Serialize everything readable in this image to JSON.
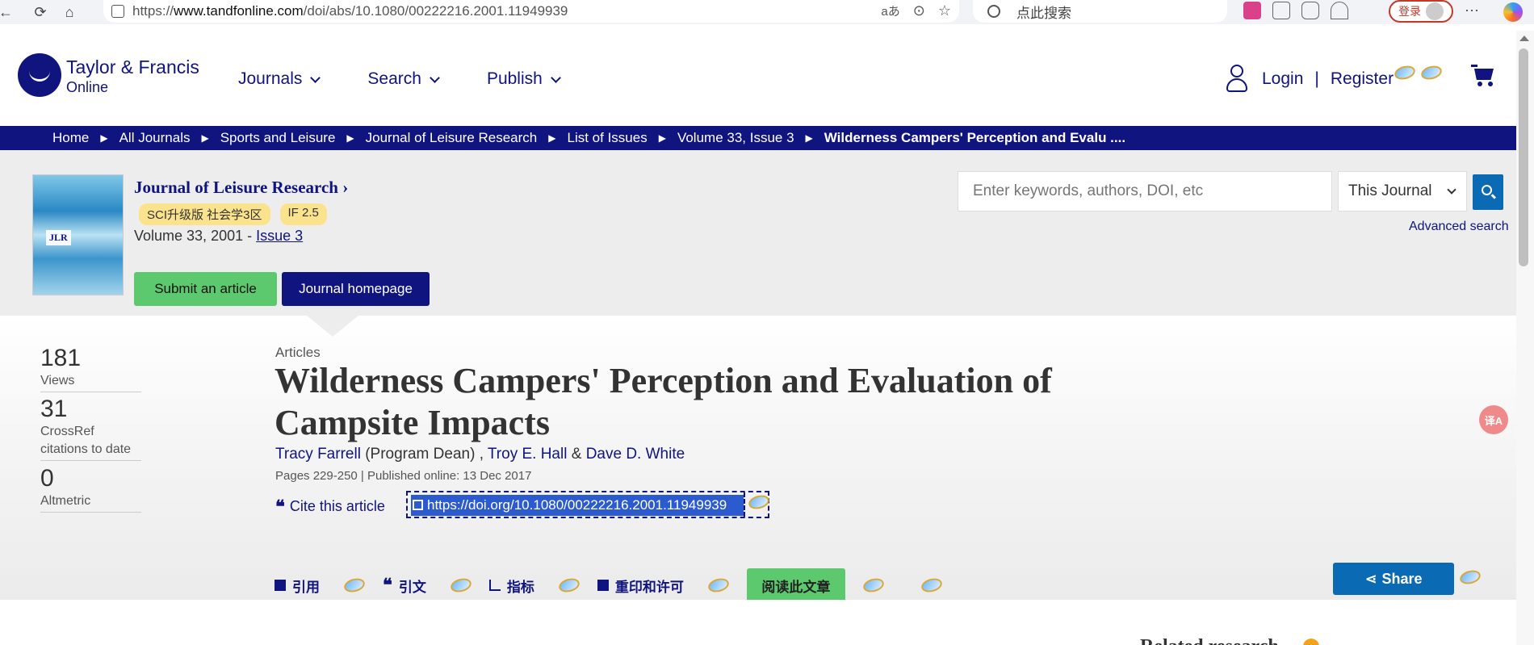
{
  "browser": {
    "url_prefix": "https://",
    "url_host": "www.tandfonline.com",
    "url_path": "/doi/abs/10.1080/00222216.2001.11949939",
    "search_placeholder": "点此搜索",
    "login_label": "登录",
    "reader_mode_label": "aあ"
  },
  "header": {
    "logo_line1": "Taylor & Francis",
    "logo_line2": "Online",
    "nav": [
      "Journals",
      "Search",
      "Publish"
    ],
    "login": "Login",
    "divider": "|",
    "register": "Register"
  },
  "breadcrumb": [
    "Home",
    "All Journals",
    "Sports and Leisure",
    "Journal of Leisure Research",
    "List of Issues",
    "Volume 33, Issue 3",
    "Wilderness Campers' Perception and Evalu ...."
  ],
  "journal": {
    "cover_text": "JLR",
    "title": "Journal of Leisure Research ›",
    "badges": [
      "SCI升级版 社会学3区",
      "IF 2.5"
    ],
    "volume_text": "Volume 33, 2001 - ",
    "issue_link": "Issue 3",
    "submit_label": "Submit an article",
    "homepage_label": "Journal homepage",
    "search_placeholder": "Enter keywords, authors, DOI, etc",
    "scope_select": "This Journal",
    "advanced_search": "Advanced search"
  },
  "metrics": [
    {
      "value": "181",
      "label": "Views"
    },
    {
      "value": "31",
      "label": "CrossRef citations to date"
    },
    {
      "value": "0",
      "label": "Altmetric"
    }
  ],
  "article": {
    "type": "Articles",
    "title": "Wilderness Campers' Perception and Evaluation of Campsite Impacts",
    "author1": "Tracy Farrell",
    "author1_role": " (Program Dean) , ",
    "author2": "Troy E. Hall",
    "amp": " & ",
    "author3": "Dave D. White",
    "pub_info": "Pages 229-250 | Published online: 13 Dec 2017",
    "cite_label": "Cite this article",
    "doi": "https://doi.org/10.1080/00222216.2001.11949939"
  },
  "tabs": {
    "cite": "引用",
    "citations": "引文",
    "metrics": "指标",
    "reprints": "重印和许可",
    "read": "阅读此文章",
    "share": "Share"
  },
  "related": "Related research",
  "translate_fab": "译A",
  "colors": {
    "brand": "#10147e",
    "green": "#5cc96e",
    "blue": "#0a6ab3",
    "badge": "#fbe38d"
  }
}
